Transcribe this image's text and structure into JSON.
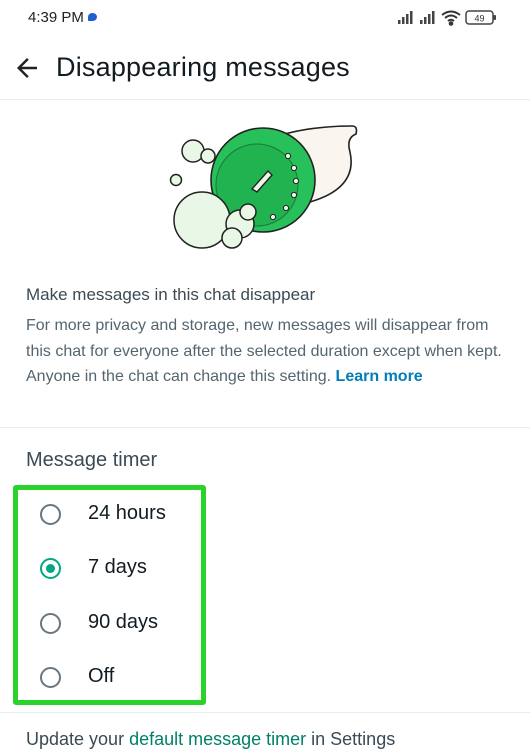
{
  "status_bar": {
    "time": "4:39 PM",
    "battery": "49",
    "icons": [
      "signal-icon",
      "signal-icon",
      "wifi-icon",
      "battery-icon"
    ]
  },
  "app_bar": {
    "back_icon": "arrow-left-icon",
    "title": "Disappearing messages"
  },
  "info": {
    "heading": "Make messages in this chat disappear",
    "description": "For more privacy and storage, new messages will disappear from this chat for everyone after the selected duration except when kept. Anyone in the chat can change this setting. ",
    "learn_more": "Learn more"
  },
  "timer": {
    "heading": "Message timer",
    "options": [
      {
        "label": "24 hours",
        "selected": false
      },
      {
        "label": "7 days",
        "selected": true
      },
      {
        "label": "90 days",
        "selected": false
      },
      {
        "label": "Off",
        "selected": false
      }
    ]
  },
  "footer": {
    "prefix": "Update your ",
    "link": "default message timer",
    "suffix": " in Settings"
  },
  "colors": {
    "accent": "#00a884",
    "link": "#027eb5",
    "highlight": "#2bd22b"
  }
}
